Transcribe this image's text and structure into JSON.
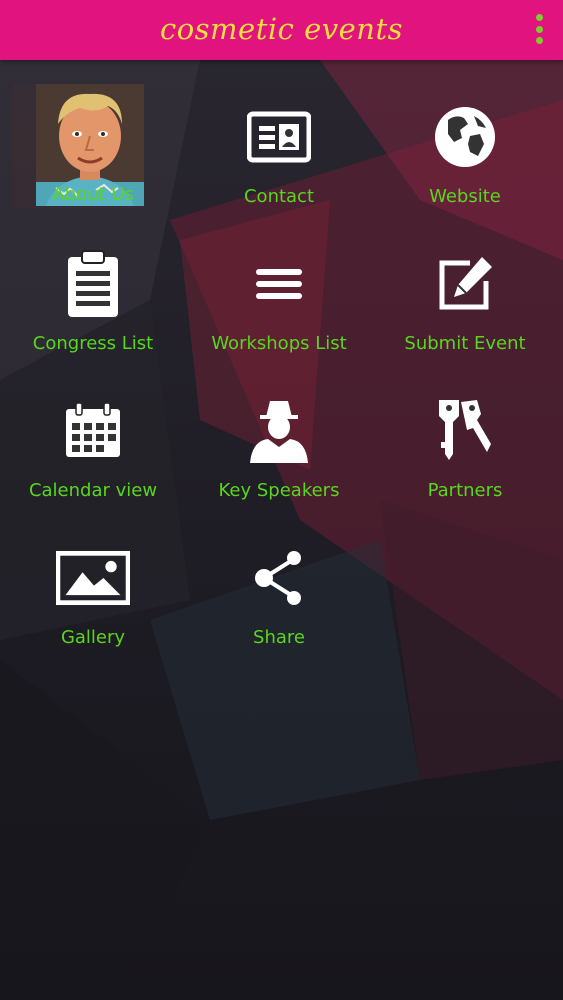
{
  "app_bar": {
    "title": "cosmetic events",
    "overflow_menu_icon": "more-vert-icon"
  },
  "colors": {
    "app_bar": "#e0137f",
    "title": "#f1df3e",
    "label": "#59d61e",
    "menu_dots": "#7ccf2b",
    "icon": "#ffffff"
  },
  "menu": [
    {
      "label": "About Us",
      "icon": "avatar-photo"
    },
    {
      "label": "Contact",
      "icon": "contact-card-icon"
    },
    {
      "label": "Website",
      "icon": "globe-icon"
    },
    {
      "label": "Congress List",
      "icon": "clipboard-icon"
    },
    {
      "label": "Workshops List",
      "icon": "list-lines-icon"
    },
    {
      "label": "Submit Event",
      "icon": "edit-icon"
    },
    {
      "label": "Calendar view",
      "icon": "calendar-icon"
    },
    {
      "label": "Key Speakers",
      "icon": "speaker-person-icon"
    },
    {
      "label": "Partners",
      "icon": "keys-icon"
    },
    {
      "label": "Gallery",
      "icon": "image-icon"
    },
    {
      "label": "Share",
      "icon": "share-icon"
    }
  ]
}
